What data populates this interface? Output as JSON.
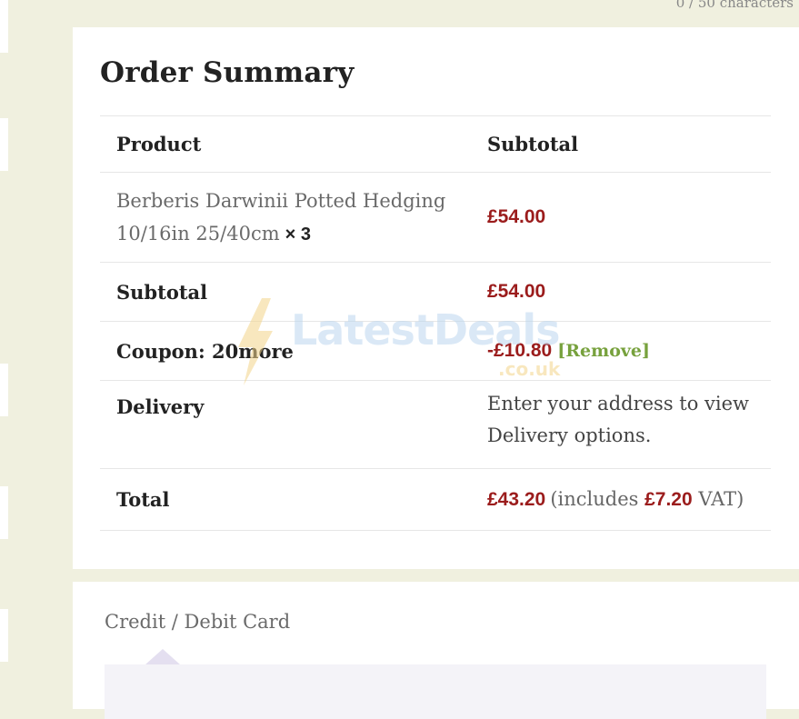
{
  "char_counter": "0 / 50 characters",
  "order_summary": {
    "title": "Order Summary",
    "headers": {
      "product": "Product",
      "subtotal": "Subtotal"
    },
    "item": {
      "name": "Berberis Darwinii Potted Hedging 10/16in 25/40cm",
      "qty": "× 3",
      "price": "£54.00"
    },
    "subtotal": {
      "label": "Subtotal",
      "value": "£54.00"
    },
    "coupon": {
      "label": "Coupon: 20more",
      "value": "-£10.80",
      "remove_label": "[Remove]"
    },
    "delivery": {
      "label": "Delivery",
      "text": "Enter your address to view Delivery options."
    },
    "total": {
      "label": "Total",
      "value": "£43.20",
      "vat_prefix": "(includes",
      "vat_value": "£7.20",
      "vat_suffix": "VAT)"
    }
  },
  "watermark": {
    "brand": "LatestDeals",
    "tld": ".co.uk"
  },
  "payment": {
    "method_label": "Credit / Debit Card"
  },
  "colors": {
    "price": "#9b1c1c",
    "remove_link": "#77a13d",
    "page_bg": "#f0f0df",
    "watermark_bolt": "#f3d48a",
    "watermark_text": "#bcd7ef"
  }
}
